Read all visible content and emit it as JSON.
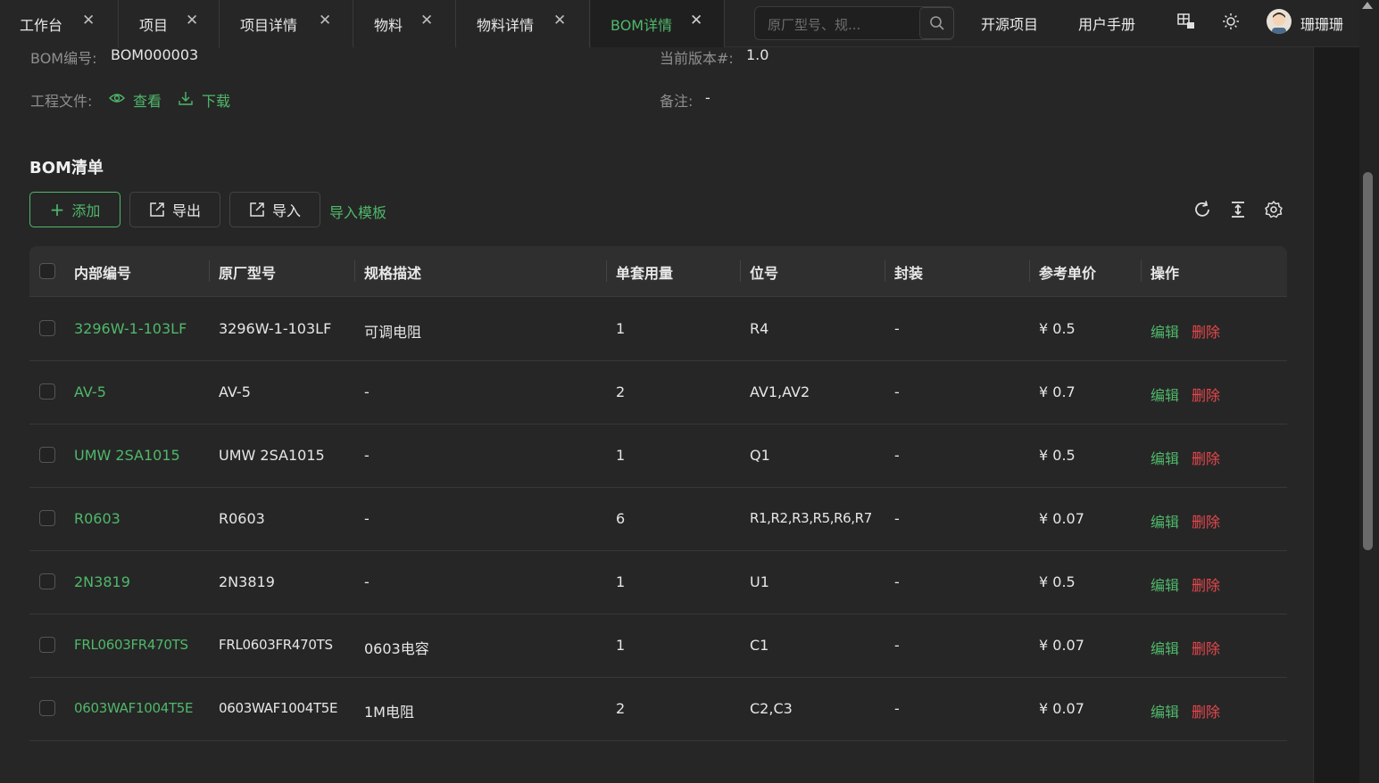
{
  "tabs": [
    {
      "label": "工作台",
      "active": false
    },
    {
      "label": "项目",
      "active": false
    },
    {
      "label": "项目详情",
      "active": false
    },
    {
      "label": "物料",
      "active": false
    },
    {
      "label": "物料详情",
      "active": false
    },
    {
      "label": "BOM详情",
      "active": true
    }
  ],
  "search": {
    "placeholder": "原厂型号、规..."
  },
  "header": {
    "open_source": "开源项目",
    "manual": "用户手册",
    "user_name": "珊珊珊"
  },
  "info": {
    "bom_no_label": "BOM编号:",
    "bom_no": "BOM000003",
    "version_label": "当前版本#:",
    "version": "1.0",
    "files_label": "工程文件:",
    "view": "查看",
    "download": "下载",
    "remark_label": "备注:",
    "remark": "-"
  },
  "section": {
    "title": "BOM清单"
  },
  "toolbar": {
    "add": "添加",
    "export": "导出",
    "import": "导入",
    "template": "导入模板"
  },
  "table": {
    "columns": [
      "内部编号",
      "原厂型号",
      "规格描述",
      "单套用量",
      "位号",
      "封装",
      "参考单价",
      "操作"
    ],
    "edit_label": "编辑",
    "delete_label": "删除",
    "rows": [
      {
        "internal": "3296W-1-103LF",
        "mpn": "3296W-1-103LF",
        "spec": "可调电阻",
        "qty": "1",
        "ref": "R4",
        "pkg": "-",
        "price": "¥ 0.5"
      },
      {
        "internal": "AV-5",
        "mpn": "AV-5",
        "spec": "-",
        "qty": "2",
        "ref": "AV1,AV2",
        "pkg": "-",
        "price": "¥ 0.7"
      },
      {
        "internal": "UMW 2SA1015",
        "mpn": "UMW 2SA1015",
        "spec": "-",
        "qty": "1",
        "ref": "Q1",
        "pkg": "-",
        "price": "¥ 0.5"
      },
      {
        "internal": "R0603",
        "mpn": "R0603",
        "spec": "-",
        "qty": "6",
        "ref": "R1,R2,R3,R5,R6,R7",
        "pkg": "-",
        "price": "¥ 0.07"
      },
      {
        "internal": "2N3819",
        "mpn": "2N3819",
        "spec": "-",
        "qty": "1",
        "ref": "U1",
        "pkg": "-",
        "price": "¥ 0.5"
      },
      {
        "internal": "FRL0603FR470TS",
        "mpn": "FRL0603FR470TS",
        "spec": "0603电容",
        "qty": "1",
        "ref": "C1",
        "pkg": "-",
        "price": "¥ 0.07"
      },
      {
        "internal": "0603WAF1004T5E",
        "mpn": "0603WAF1004T5E",
        "spec": "1M电阻",
        "qty": "2",
        "ref": "C2,C3",
        "pkg": "-",
        "price": "¥ 0.07"
      }
    ]
  },
  "colors": {
    "accent": "#4fb86a",
    "danger": "#e5484d",
    "background": "#262626"
  }
}
